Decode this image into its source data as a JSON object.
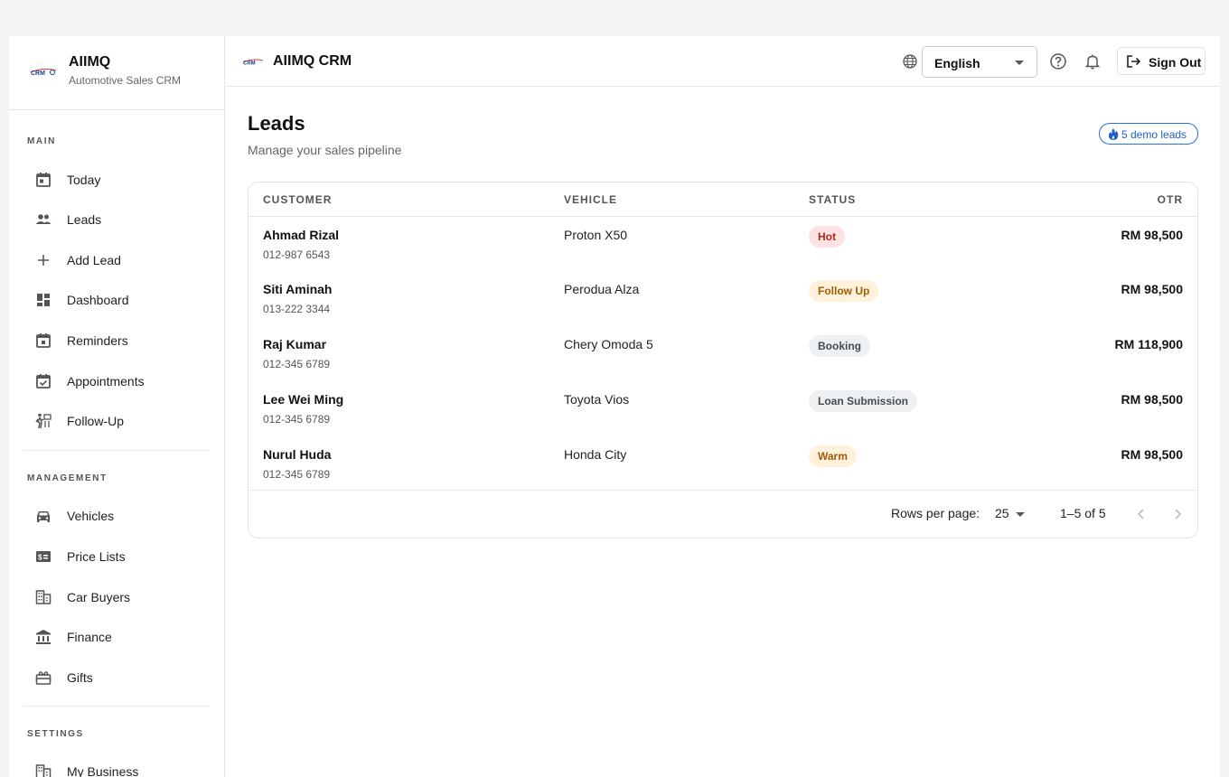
{
  "sidebar": {
    "brand": {
      "title": "AIIMQ",
      "subtitle": "Automotive Sales CRM",
      "logo_icon": "crm-logo-icon"
    },
    "sections": [
      {
        "label": "MAIN"
      },
      {
        "label": "MANAGEMENT"
      },
      {
        "label": "SETTINGS"
      }
    ],
    "items": [
      {
        "label": "Today",
        "icon": "calendar-today-icon"
      },
      {
        "label": "Leads",
        "icon": "people-icon"
      },
      {
        "label": "Add Lead",
        "icon": "plus-icon"
      },
      {
        "label": "Dashboard",
        "icon": "dashboard-icon"
      },
      {
        "label": "Reminders",
        "icon": "calendar-icon"
      },
      {
        "label": "Appointments",
        "icon": "calendar-check-icon"
      },
      {
        "label": "Follow-Up",
        "icon": "follow-up-icon"
      },
      {
        "label": "Vehicles",
        "icon": "car-icon"
      },
      {
        "label": "Price Lists",
        "icon": "price-tag-icon"
      },
      {
        "label": "Car Buyers",
        "icon": "building-icon"
      },
      {
        "label": "Finance",
        "icon": "bank-icon"
      },
      {
        "label": "Gifts",
        "icon": "gift-icon"
      },
      {
        "label": "My Business",
        "icon": "business-icon"
      }
    ]
  },
  "header": {
    "title": "AIIMQ CRM",
    "language": {
      "selected": "English"
    },
    "sign_out_label": "Sign Out"
  },
  "main": {
    "title": "Leads",
    "subtitle": "Manage your sales pipeline",
    "demo_badge": "5 demo leads",
    "table": {
      "columns": [
        "CUSTOMER",
        "VEHICLE",
        "STATUS",
        "OTR"
      ],
      "rows": [
        {
          "name": "Ahmad Rizal",
          "phone": "012-987 6543",
          "vehicle": "Proton X50",
          "status": "Hot",
          "otr": "RM 98,500"
        },
        {
          "name": "Siti Aminah",
          "phone": "013-222 3344",
          "vehicle": "Perodua Alza",
          "status": "Follow Up",
          "otr": "RM 98,500"
        },
        {
          "name": "Raj Kumar",
          "phone": "012-345 6789",
          "vehicle": "Chery Omoda 5",
          "status": "Booking",
          "otr": "RM 118,900"
        },
        {
          "name": "Lee Wei Ming",
          "phone": "012-345 6789",
          "vehicle": "Toyota Vios",
          "status": "Loan Submission",
          "otr": "RM 98,500"
        },
        {
          "name": "Nurul Huda",
          "phone": "012-345 6789",
          "vehicle": "Honda City",
          "status": "Warm",
          "otr": "RM 98,500"
        }
      ],
      "footer": {
        "rows_per_page_label": "Rows per page:",
        "rows_per_page": "25",
        "range": "1–5 of 5"
      }
    }
  },
  "colors": {
    "accent": "#1f5fc9",
    "status_hot_bg": "#fde2e4",
    "status_hot_fg": "#b42318",
    "status_follow_bg": "#fff1dc",
    "status_follow_fg": "#a15c07",
    "status_neutral_bg": "#eef0f2",
    "status_neutral_fg": "#444c56",
    "status_warm_bg": "#fff1dc",
    "status_warm_fg": "#a15c07"
  }
}
